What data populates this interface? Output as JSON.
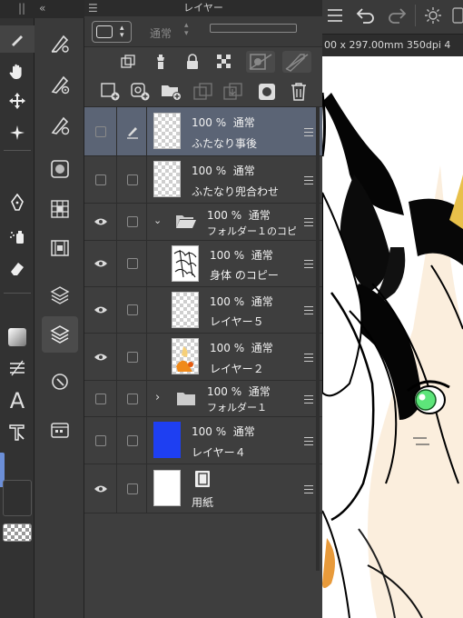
{
  "toolbar_icons": [
    "brush-icon",
    "hand-icon",
    "move-icon",
    "magic-icon",
    "pen-icon",
    "spray-icon",
    "eraser-icon",
    "fill-icon",
    "ruler-icon",
    "text-icon",
    "operation-icon"
  ],
  "panel": {
    "title": "レイヤー",
    "blend_mode": "通常",
    "menu_glyph": "☰"
  },
  "layers": [
    {
      "opacity": "100 %",
      "mode": "通常",
      "name": "ふたなり事後",
      "selected": true
    },
    {
      "opacity": "100 %",
      "mode": "通常",
      "name": "ふたなり兜合わせ"
    },
    {
      "opacity": "100 %",
      "mode": "通常",
      "name": "フォルダー１のコピー",
      "type": "folder",
      "expanded": true
    },
    {
      "opacity": "100 %",
      "mode": "通常",
      "name": "身体 のコピー"
    },
    {
      "opacity": "100 %",
      "mode": "通常",
      "name": "レイヤー５"
    },
    {
      "opacity": "100 %",
      "mode": "通常",
      "name": "レイヤー２"
    },
    {
      "opacity": "100 %",
      "mode": "通常",
      "name": "フォルダー１",
      "type": "folder"
    },
    {
      "opacity": "100 %",
      "mode": "通常",
      "name": "レイヤー４",
      "color": "#1e3ff2"
    },
    {
      "name": "用紙",
      "type": "paper"
    }
  ],
  "canvas": {
    "info": "00 x 297.00mm 350dpi 4"
  },
  "colors": {
    "selected_row": "#5b6475",
    "panel_bg": "#3e3e3e",
    "eye_green": "#3ad26a"
  }
}
